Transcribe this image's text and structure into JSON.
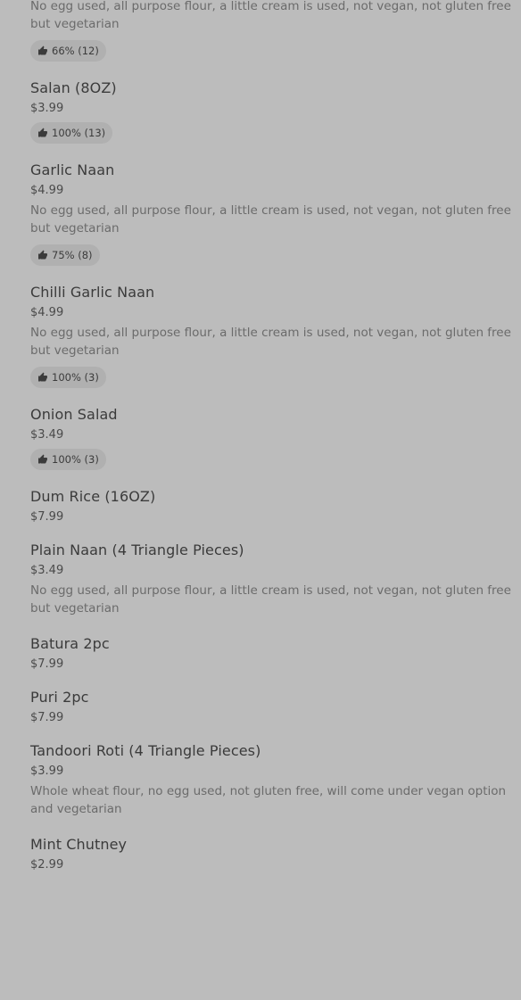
{
  "menu": {
    "items": [
      {
        "name": "",
        "price": "",
        "description": "No egg used, all purpose flour, a little cream is used, not vegan, not gluten free but vegetarian",
        "rating": "66% (12)"
      },
      {
        "name": "Salan (8OZ)",
        "price": "$3.99",
        "description": "",
        "rating": "100% (13)"
      },
      {
        "name": "Garlic Naan",
        "price": "$4.99",
        "description": "No egg used, all purpose flour, a little cream is used, not vegan, not gluten free but vegetarian",
        "rating": "75% (8)"
      },
      {
        "name": "Chilli Garlic Naan",
        "price": "$4.99",
        "description": "No egg used, all purpose flour, a little cream is used, not vegan, not gluten free but vegetarian",
        "rating": "100% (3)"
      },
      {
        "name": "Onion Salad",
        "price": "$3.49",
        "description": "",
        "rating": "100% (3)"
      },
      {
        "name": "Dum Rice (16OZ)",
        "price": "$7.99",
        "description": "",
        "rating": ""
      },
      {
        "name": "Plain Naan (4 Triangle Pieces)",
        "price": "$3.49",
        "description": "No egg used, all purpose flour, a little cream is used, not vegan, not gluten free but vegetarian",
        "rating": ""
      },
      {
        "name": "Batura 2pc",
        "price": "$7.99",
        "description": "",
        "rating": ""
      },
      {
        "name": "Puri 2pc",
        "price": "$7.99",
        "description": "",
        "rating": ""
      },
      {
        "name": "Tandoori Roti (4 Triangle Pieces)",
        "price": "$3.99",
        "description": "Whole wheat flour, no egg used, not gluten free, will come under vegan option and vegetarian",
        "rating": ""
      },
      {
        "name": "Mint Chutney",
        "price": "$2.99",
        "description": "",
        "rating": ""
      }
    ]
  },
  "icons": {
    "rating": "thumbs-up-icon"
  },
  "colors": {
    "background": "#bcbcbc",
    "pill_background": "#b0b0b0",
    "text_primary": "#3b3b3b",
    "text_secondary": "#6b6b6b"
  }
}
